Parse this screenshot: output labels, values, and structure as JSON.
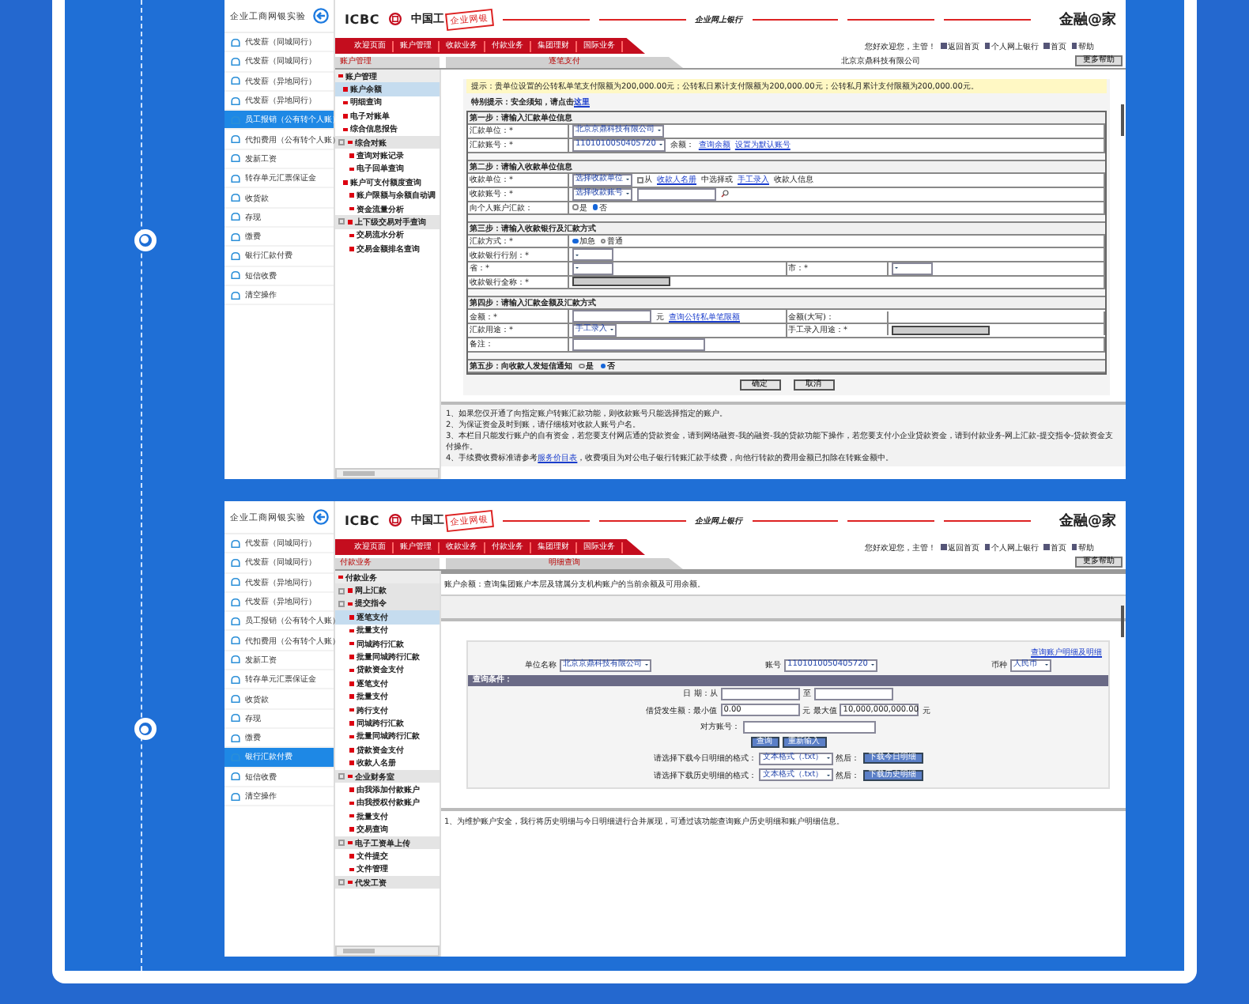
{
  "panels": [
    {
      "sidebar": {
        "title": "企业工商网银实验",
        "items": [
          {
            "label": "代发薪（同城同行）",
            "selected": false
          },
          {
            "label": "代发薪（同城同行）",
            "selected": false
          },
          {
            "label": "代发薪（异地同行）",
            "selected": false
          },
          {
            "label": "代发薪（异地同行）",
            "selected": false
          },
          {
            "label": "员工报销（公有转个人账）",
            "selected": true
          },
          {
            "label": "代扣费用（公有转个人账）",
            "selected": false
          },
          {
            "label": "发新工资",
            "selected": false
          },
          {
            "label": "转存单元汇票保证金",
            "selected": false
          },
          {
            "label": "收货款",
            "selected": false
          },
          {
            "label": "存现",
            "selected": false
          },
          {
            "label": "缴费",
            "selected": false
          },
          {
            "label": "银行汇款付费",
            "selected": false
          },
          {
            "label": "短信收费",
            "selected": false
          },
          {
            "label": "清空操作",
            "selected": false
          }
        ]
      },
      "header": {
        "logo": "ICBC",
        "bank_name": "中国工",
        "stamp": "企业网银",
        "slogan": "企业网上银行",
        "brand": "金融@家"
      },
      "nav": {
        "tabs": [
          "欢迎页面",
          "账户管理",
          "收款业务",
          "付款业务",
          "集团理财",
          "国际业务"
        ],
        "greeting": "您好欢迎您，主管！",
        "links": [
          "返回首页",
          "个人网上银行",
          "首页",
          "帮助"
        ]
      },
      "menu": {
        "tab": "账户管理",
        "items": [
          {
            "label": "账户管理",
            "kind": "root",
            "selected": false
          },
          {
            "label": "账户余额",
            "kind": "item",
            "selected": true
          },
          {
            "label": "明细查询",
            "kind": "item",
            "selected": false
          },
          {
            "label": "电子对账单",
            "kind": "item",
            "selected": false
          },
          {
            "label": "综合信息报告",
            "kind": "item",
            "selected": false
          },
          {
            "label": "综合对账",
            "kind": "section",
            "selected": false
          },
          {
            "label": "查询对账记录",
            "kind": "sub",
            "selected": false
          },
          {
            "label": "电子回单查询",
            "kind": "sub",
            "selected": false
          },
          {
            "label": "账户可支付额度查询",
            "kind": "item",
            "selected": false
          },
          {
            "label": "账户限额与余额自动调",
            "kind": "sub",
            "selected": false
          },
          {
            "label": "资金流量分析",
            "kind": "sub",
            "selected": false
          },
          {
            "label": "上下级交易对手查询",
            "kind": "section",
            "selected": false
          },
          {
            "label": "交易流水分析",
            "kind": "sub",
            "selected": false
          },
          {
            "label": "交易金额排名查询",
            "kind": "sub",
            "selected": false
          }
        ]
      },
      "breadcrumb": {
        "tab": "逐笔支付",
        "company": "北京京鼎科技有限公司",
        "help": "更多帮助"
      },
      "content": {
        "kind": "transfer_form",
        "notice": "提示：贵单位设置的公转私单笔支付限额为200,000.00元；公转私日累计支付限额为200,000.00元；公转私月累计支付限额为200,000.00元。",
        "tip": "特别提示：安全须知，请点击",
        "tip_link": "这里",
        "rows": [
          {
            "kind": "heading",
            "text": "第一步：请输入汇款单位信息"
          },
          {
            "kind": "field",
            "cells": [
              {
                "label": "汇款单位：*",
                "controls": [
                  {
                    "kind": "select",
                    "text": "北京京鼎科技有限公司"
                  }
                ]
              }
            ]
          },
          {
            "kind": "field",
            "cells": [
              {
                "label": "汇款账号：*",
                "controls": [
                  {
                    "kind": "select",
                    "text": "1101010050405720"
                  },
                  {
                    "kind": "text",
                    "text": "余额："
                  },
                  {
                    "kind": "link",
                    "text": "查询余额"
                  },
                  {
                    "kind": "link",
                    "text": "设置为默认账号"
                  }
                ]
              }
            ]
          },
          {
            "kind": "spacer"
          },
          {
            "kind": "heading",
            "text": "第二步：请输入收款单位信息"
          },
          {
            "kind": "field",
            "cells": [
              {
                "label": "收款单位：*",
                "controls": [
                  {
                    "kind": "select",
                    "text": "选择收款单位"
                  },
                  {
                    "kind": "checkbox",
                    "checked": false,
                    "text": "从"
                  },
                  {
                    "kind": "link",
                    "text": "收款人名册"
                  },
                  {
                    "kind": "text",
                    "text": "中选择或"
                  },
                  {
                    "kind": "link",
                    "text": "手工录入"
                  },
                  {
                    "kind": "text",
                    "text": "收款人信息"
                  }
                ]
              }
            ]
          },
          {
            "kind": "field",
            "cells": [
              {
                "label": "收款账号：*",
                "controls": [
                  {
                    "kind": "select",
                    "text": "选择收款账号"
                  },
                  {
                    "kind": "input"
                  },
                  {
                    "kind": "search"
                  }
                ]
              }
            ]
          },
          {
            "kind": "field",
            "cells": [
              {
                "label": "向个人账户汇款：",
                "controls": [
                  {
                    "kind": "radio",
                    "text": "是",
                    "selected": false
                  },
                  {
                    "kind": "radio",
                    "text": "否",
                    "selected": true
                  }
                ]
              }
            ]
          },
          {
            "kind": "spacer"
          },
          {
            "kind": "heading",
            "text": "第三步：请输入收款银行及汇款方式"
          },
          {
            "kind": "field",
            "cells": [
              {
                "label": "汇款方式：*",
                "controls": [
                  {
                    "kind": "radio",
                    "text": "加急",
                    "selected": true
                  },
                  {
                    "kind": "radio",
                    "text": "普通",
                    "selected": false
                  }
                ]
              }
            ]
          },
          {
            "kind": "field",
            "cells": [
              {
                "label": "收款银行行别：*",
                "controls": [
                  {
                    "kind": "select"
                  }
                ]
              }
            ]
          },
          {
            "kind": "field",
            "cells": [
              {
                "label": "省：*",
                "controls": [
                  {
                    "kind": "select"
                  }
                ]
              },
              {
                "label": "市：*",
                "controls": [
                  {
                    "kind": "select"
                  }
                ]
              }
            ]
          },
          {
            "kind": "field",
            "cells": [
              {
                "label": "收款银行全称：*",
                "controls": [
                  {
                    "kind": "readonly"
                  }
                ]
              }
            ]
          },
          {
            "kind": "spacer"
          },
          {
            "kind": "heading",
            "text": "第四步：请输入汇款金额及汇款方式"
          },
          {
            "kind": "field",
            "cells": [
              {
                "label": "金额：*",
                "controls": [
                  {
                    "kind": "input"
                  },
                  {
                    "kind": "text",
                    "text": "元"
                  },
                  {
                    "kind": "link",
                    "text": "查询公转私单笔限额"
                  }
                ]
              },
              {
                "label": "金额(大写)："
              }
            ]
          },
          {
            "kind": "field",
            "cells": [
              {
                "label": "汇款用途：*",
                "controls": [
                  {
                    "kind": "select",
                    "text": "手工录入"
                  }
                ]
              },
              {
                "label": "手工录入用途：*",
                "controls": [
                  {
                    "kind": "readonly"
                  }
                ]
              }
            ]
          },
          {
            "kind": "field",
            "cells": [
              {
                "label": "备注：",
                "controls": [
                  {
                    "kind": "long_input"
                  }
                ]
              }
            ]
          },
          {
            "kind": "spacer"
          },
          {
            "kind": "heading",
            "text": "第五步：向收款人发短信通知",
            "controls": [
              {
                "kind": "radio",
                "text": "是",
                "selected": false
              },
              {
                "kind": "radio",
                "text": "否",
                "selected": true
              }
            ]
          }
        ],
        "buttons": [
          "确定",
          "取消"
        ],
        "notes": [
          {
            "text": "1、如果您仅开通了向指定账户转账汇款功能，则收款账号只能选择指定的账户。"
          },
          {
            "text": "2、为保证资金及时到账，请仔细核对收款人账号户名。"
          },
          {
            "text": "3、本栏目只能发行账户的自有资金，若您要支付网店通的贷款资金，请到网络融资-我的融资-我的贷款功能下操作，若您要支付小企业贷款资金，请到付款业务-网上汇款-提交指令-贷款资金支付操作。"
          },
          {
            "text": "4、手续费收费标准请参考",
            "link": "服务价目表",
            "rest": "，收费项目为对公电子银行转账汇款手续费，向他行转款的费用金额已扣除在转账金额中。"
          }
        ]
      }
    },
    {
      "sidebar": {
        "title": "企业工商网银实验",
        "items": [
          {
            "label": "代发薪（同城同行）",
            "selected": false
          },
          {
            "label": "代发薪（同城同行）",
            "selected": false
          },
          {
            "label": "代发薪（异地同行）",
            "selected": false
          },
          {
            "label": "代发薪（异地同行）",
            "selected": false
          },
          {
            "label": "员工报销（公有转个人账）",
            "selected": false
          },
          {
            "label": "代扣费用（公有转个人账）",
            "selected": false
          },
          {
            "label": "发新工资",
            "selected": false
          },
          {
            "label": "转存单元汇票保证金",
            "selected": false
          },
          {
            "label": "收货款",
            "selected": false
          },
          {
            "label": "存现",
            "selected": false
          },
          {
            "label": "缴费",
            "selected": false
          },
          {
            "label": "银行汇款付费",
            "selected": true
          },
          {
            "label": "短信收费",
            "selected": false
          },
          {
            "label": "清空操作",
            "selected": false
          }
        ]
      },
      "header": {
        "logo": "ICBC",
        "bank_name": "中国工",
        "stamp": "企业网银",
        "slogan": "企业网上银行",
        "brand": "金融@家"
      },
      "nav": {
        "tabs": [
          "欢迎页面",
          "账户管理",
          "收款业务",
          "付款业务",
          "集团理财",
          "国际业务"
        ],
        "greeting": "您好欢迎您，主管！",
        "links": [
          "返回首页",
          "个人网上银行",
          "首页",
          "帮助"
        ]
      },
      "menu": {
        "tab": "付款业务",
        "items": [
          {
            "label": "付款业务",
            "kind": "root",
            "selected": false
          },
          {
            "label": "网上汇款",
            "kind": "section",
            "selected": false
          },
          {
            "label": "提交指令",
            "kind": "section",
            "selected": false
          },
          {
            "label": "逐笔支付",
            "kind": "sub",
            "selected": true
          },
          {
            "label": "批量支付",
            "kind": "sub",
            "selected": false
          },
          {
            "label": "同城跨行汇款",
            "kind": "sub",
            "selected": false
          },
          {
            "label": "批量同城跨行汇款",
            "kind": "sub",
            "selected": false
          },
          {
            "label": "贷款资金支付",
            "kind": "sub",
            "selected": false
          },
          {
            "label": "逐笔支付",
            "kind": "sub",
            "selected": false
          },
          {
            "label": "批量支付",
            "kind": "sub",
            "selected": false
          },
          {
            "label": "跨行支付",
            "kind": "sub",
            "selected": false
          },
          {
            "label": "同城跨行汇款",
            "kind": "sub",
            "selected": false
          },
          {
            "label": "批量同城跨行汇款",
            "kind": "sub",
            "selected": false
          },
          {
            "label": "贷款资金支付",
            "kind": "sub",
            "selected": false
          },
          {
            "label": "收款人名册",
            "kind": "sub",
            "selected": false
          },
          {
            "label": "企业财务室",
            "kind": "section",
            "selected": false
          },
          {
            "label": "由我添加付款账户",
            "kind": "sub",
            "selected": false
          },
          {
            "label": "由我授权付款账户",
            "kind": "sub",
            "selected": false
          },
          {
            "label": "批量支付",
            "kind": "sub",
            "selected": false
          },
          {
            "label": "交易查询",
            "kind": "sub",
            "selected": false
          },
          {
            "label": "电子工资单上传",
            "kind": "section",
            "selected": false
          },
          {
            "label": "文件提交",
            "kind": "sub",
            "selected": false
          },
          {
            "label": "文件管理",
            "kind": "sub",
            "selected": false
          },
          {
            "label": "代发工资",
            "kind": "section",
            "selected": false
          }
        ]
      },
      "breadcrumb": {
        "tab": "明细查询",
        "help": "更多帮助"
      },
      "content": {
        "kind": "detail_query",
        "info": "账户余额：查询集团账户本层及辖属分支机构账户的当前余额及可用余额。",
        "link": "查询账户明细及明细",
        "selectors": [
          {
            "label": "单位名称",
            "value": "北京京鼎科技有限公司"
          },
          {
            "label": "账号",
            "value": "1101010050405720"
          },
          {
            "label": "币种",
            "value": "人民币"
          }
        ],
        "bar": "查询条件：",
        "lines": [
          {
            "items": [
              {
                "kind": "text",
                "text": "日 期：从"
              },
              {
                "kind": "input"
              },
              {
                "kind": "text",
                "text": "至"
              },
              {
                "kind": "input"
              }
            ]
          },
          {
            "items": [
              {
                "kind": "text",
                "text": "借贷发生额：最小值"
              },
              {
                "kind": "input",
                "text": "0.00"
              },
              {
                "kind": "text",
                "text": "元 最大值"
              },
              {
                "kind": "input",
                "text": "10,000,000,000.00"
              },
              {
                "kind": "text",
                "text": "元"
              }
            ]
          },
          {
            "items": [
              {
                "kind": "text",
                "text": "对方账号："
              },
              {
                "kind": "long_input"
              }
            ]
          },
          {
            "items": [
              {
                "kind": "button",
                "text": "查询"
              },
              {
                "kind": "button",
                "text": "重新输入"
              }
            ]
          },
          {
            "items": [
              {
                "kind": "text",
                "text": "请选择下载今日明细的格式："
              },
              {
                "kind": "select",
                "text": "文本格式（.txt）"
              },
              {
                "kind": "text",
                "text": "然后："
              },
              {
                "kind": "button",
                "text": "下载今日明细"
              }
            ]
          },
          {
            "items": [
              {
                "kind": "text",
                "text": "请选择下载历史明细的格式："
              },
              {
                "kind": "select",
                "text": "文本格式（.txt）"
              },
              {
                "kind": "text",
                "text": "然后："
              },
              {
                "kind": "button",
                "text": "下载历史明细"
              }
            ]
          }
        ],
        "notes": [
          {
            "text": "1、为维护账户安全，我行将历史明细与今日明细进行合并展现，可通过该功能查询账户历史明细和账户明细信息。"
          }
        ]
      }
    }
  ]
}
